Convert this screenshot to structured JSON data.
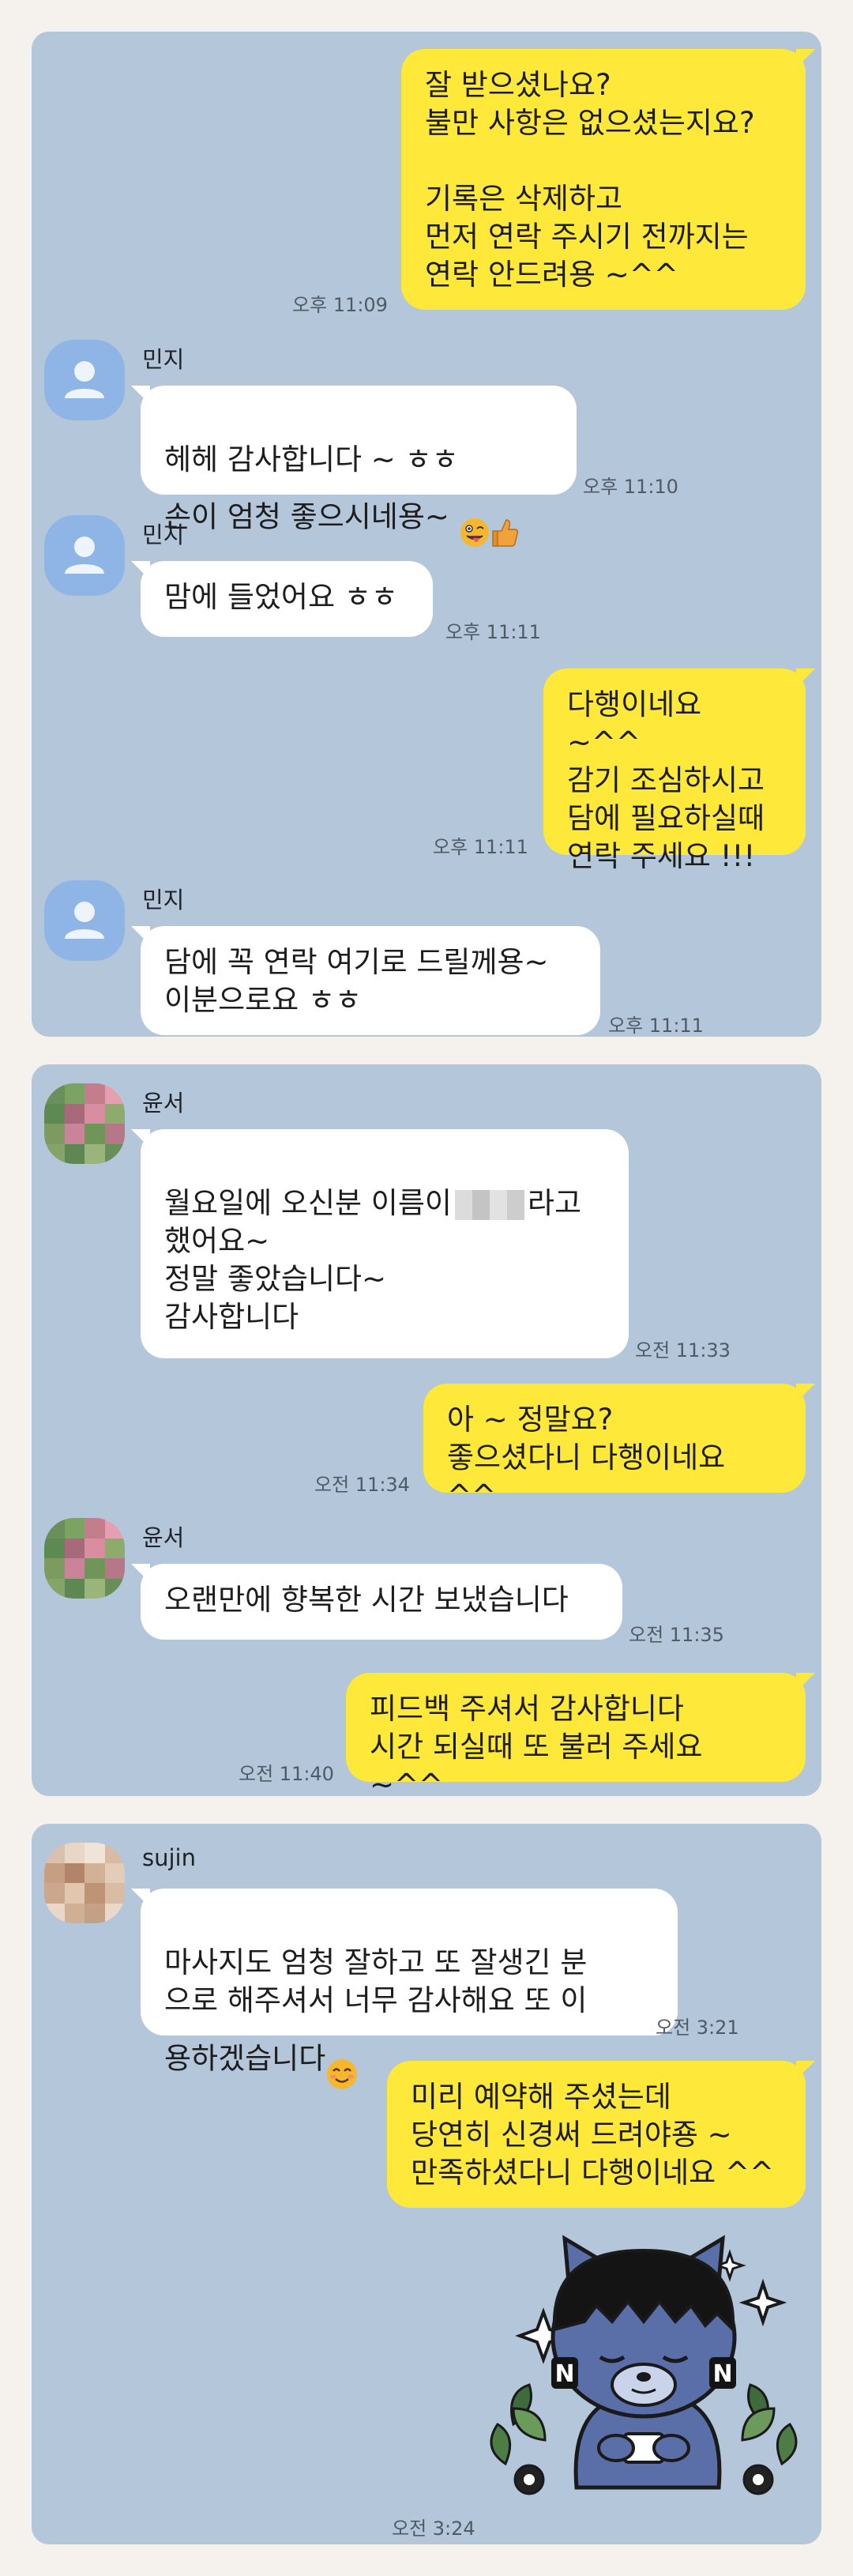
{
  "colors": {
    "chat_background": "#b3c6da",
    "page_background": "#f5f2ee",
    "outgoing_bubble": "#fee83a",
    "incoming_bubble": "#ffffff",
    "default_avatar": "#8fb5e6"
  },
  "panel1": {
    "m1": {
      "text": "잘 받으셨나요?\n불만 사항은 없으셨는지요?\n\n기록은 삭제하고\n먼저 연락 주시기 전까지는\n연락 안드려용 ~^^",
      "time": "오후 11:09"
    },
    "m2": {
      "sender": "민지",
      "text": "헤헤 감사합니다 ~ ㅎㅎ\n손이 엄청 좋으시네용~ ",
      "time": "오후 11:10"
    },
    "m3": {
      "sender": "민지",
      "text": "맘에 들었어요 ㅎㅎ",
      "time": "오후 11:11"
    },
    "m4": {
      "text": "다행이네요 ~^^\n감기 조심하시고\n담에 필요하실때\n연락 주세요 !!!",
      "time": "오후 11:11"
    },
    "m5": {
      "sender": "민지",
      "text": "담에 꼭 연락 여기로 드릴께용~\n이분으로요 ㅎㅎ",
      "time": "오후 11:11"
    }
  },
  "panel2": {
    "m1": {
      "sender": "윤서",
      "text_before": "월요일에 오신분 이름이",
      "text_after": "라고\n했어요~\n정말 좋았습니다~\n감사합니다",
      "time": "오전 11:33"
    },
    "m2": {
      "text": "아 ~ 정말요?\n좋으셨다니 다행이네요 ^^",
      "time": "오전 11:34"
    },
    "m3": {
      "sender": "윤서",
      "text": "오랜만에 향복한 시간 보냈습니다",
      "time": "오전 11:35"
    },
    "m4": {
      "text": "피드백 주셔서 감사합니다\n시간 되실때 또 불러 주세요 ~^^",
      "time": "오전 11:40"
    }
  },
  "panel3": {
    "m1": {
      "sender": "sujin",
      "text": "마사지도 엄청 잘하고 또 잘생긴 분\n으로 해주셔서 너무 감사해요 또 이\n용하겠습니다",
      "time": "오전 3:21"
    },
    "m2": {
      "text": "미리 예약해 주셨는데\n당연히 신경써 드려야죵 ~\n만족하셨다니 다행이네요 ^^",
      "time": "오전 3:24"
    },
    "sticker": {
      "icon": "sleeping-cat-character-sticker-icon"
    }
  }
}
